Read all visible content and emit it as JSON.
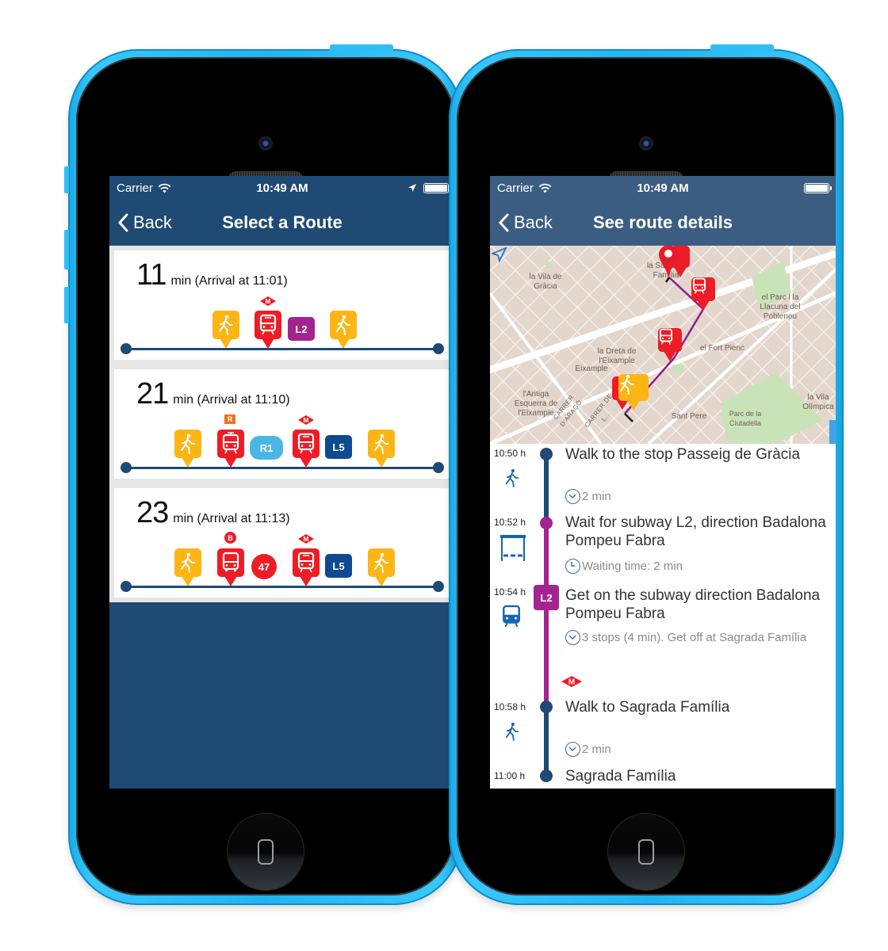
{
  "colors": {
    "phone_body": "#1fb5f2",
    "nav_left": "#1f4a73",
    "nav_right": "#3b5d82",
    "walk": "#fdb515",
    "metro_red": "#ee1c25",
    "line_L2": "#a3238f",
    "line_L5": "#0d4a8f",
    "line_R1": "#4ab6e6",
    "bus_47": "#ee1c25",
    "timeline_walk": "#1f4a73",
    "timeline_subway": "#a3238f",
    "rodalies": "#f47217"
  },
  "left_screen": {
    "status_bar": {
      "carrier": "Carrier",
      "time": "10:49 AM",
      "icons": [
        "wifi-icon",
        "location-arrow-icon",
        "battery-icon"
      ]
    },
    "nav": {
      "back_label": "Back",
      "title": "Select a Route"
    },
    "routes": [
      {
        "minutes": "11",
        "arrival": "min (Arrival at 11:01)",
        "legs": [
          {
            "type": "walk"
          },
          {
            "type": "metro",
            "network": "M",
            "line": "L2"
          },
          {
            "type": "walk"
          }
        ]
      },
      {
        "minutes": "21",
        "arrival": "min (Arrival at 11:10)",
        "legs": [
          {
            "type": "walk"
          },
          {
            "type": "train",
            "network": "R",
            "line": "R1"
          },
          {
            "type": "metro",
            "network": "M",
            "line": "L5"
          },
          {
            "type": "walk"
          }
        ]
      },
      {
        "minutes": "23",
        "arrival": "min (Arrival at 11:13)",
        "legs": [
          {
            "type": "walk"
          },
          {
            "type": "bus",
            "network": "B",
            "line": "47"
          },
          {
            "type": "metro",
            "network": "M",
            "line": "L5"
          },
          {
            "type": "walk"
          }
        ]
      }
    ]
  },
  "right_screen": {
    "status_bar": {
      "carrier": "Carrier",
      "time": "10:49 AM",
      "icons": [
        "wifi-icon",
        "battery-icon"
      ]
    },
    "nav": {
      "back_label": "Back",
      "title": "See route details"
    },
    "map": {
      "labels": [
        "la Vila de Gràcia",
        "la Sagrada Família",
        "el Parc i la Llacuna del Poblenou",
        "el Fort Pienc",
        "la Dreta de l'Eixample",
        "Eixample",
        "l'Antiga Esquerra de l'Eixample",
        "Sant Pere",
        "Parc de la Ciutadella",
        "la Vila Olímpica",
        "CARRER D'ARAGÓ",
        "CARRER DE L..."
      ]
    },
    "steps": [
      {
        "time": "10:50 h",
        "mode": "walk",
        "title": "Walk to the stop Passeig de Gràcia",
        "sub": "2 min",
        "sub_icon": "chevron-down-circle-icon"
      },
      {
        "time": "10:52 h",
        "mode": "wait",
        "title": "Wait for subway L2, direction Badalona Pompeu Fabra",
        "sub": "Waiting time: 2 min",
        "sub_icon": "clock-icon"
      },
      {
        "time": "10:54 h",
        "mode": "subway",
        "line": "L2",
        "title": "Get on the subway direction Badalona Pompeu Fabra",
        "sub": "3 stops (4 min). Get off at Sagrada Família",
        "sub_icon": "chevron-down-circle-icon",
        "network": "M"
      },
      {
        "time": "10:58 h",
        "mode": "walk",
        "title": "Walk to Sagrada Família",
        "sub": "2 min",
        "sub_icon": "chevron-down-circle-icon"
      },
      {
        "time": "11:00 h",
        "mode": "end",
        "title": "Sagrada Família"
      }
    ]
  }
}
